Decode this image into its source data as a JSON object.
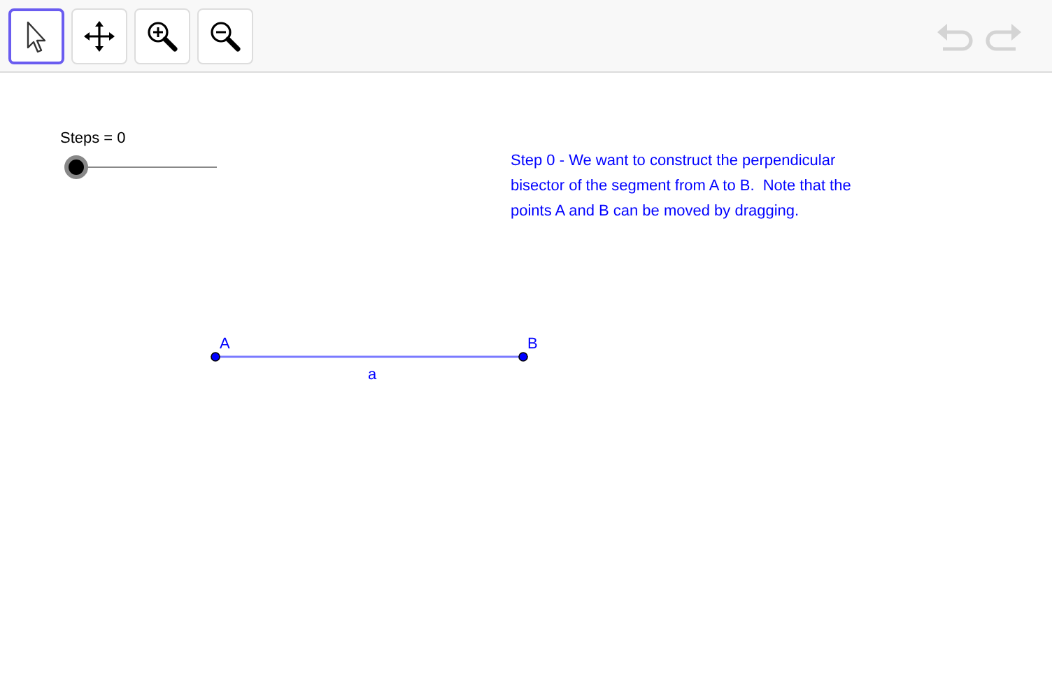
{
  "toolbar": {
    "tools": [
      {
        "kind": "pointer",
        "selected": true
      },
      {
        "kind": "move",
        "selected": false
      },
      {
        "kind": "zoom-in",
        "selected": false
      },
      {
        "kind": "zoom-out",
        "selected": false
      }
    ],
    "history": [
      {
        "kind": "undo",
        "disabled": true
      },
      {
        "kind": "redo",
        "disabled": true
      }
    ]
  },
  "slider": {
    "label": "Steps = 0",
    "level": 0
  },
  "note": "Step 0 - We want to construct the perpendicular\nbisector of the segment from A to B.  Note that the\npoints A and B can be moved by dragging.",
  "points": [
    {
      "label": "A"
    },
    {
      "label": "B"
    }
  ],
  "segment": {
    "label": "a"
  }
}
